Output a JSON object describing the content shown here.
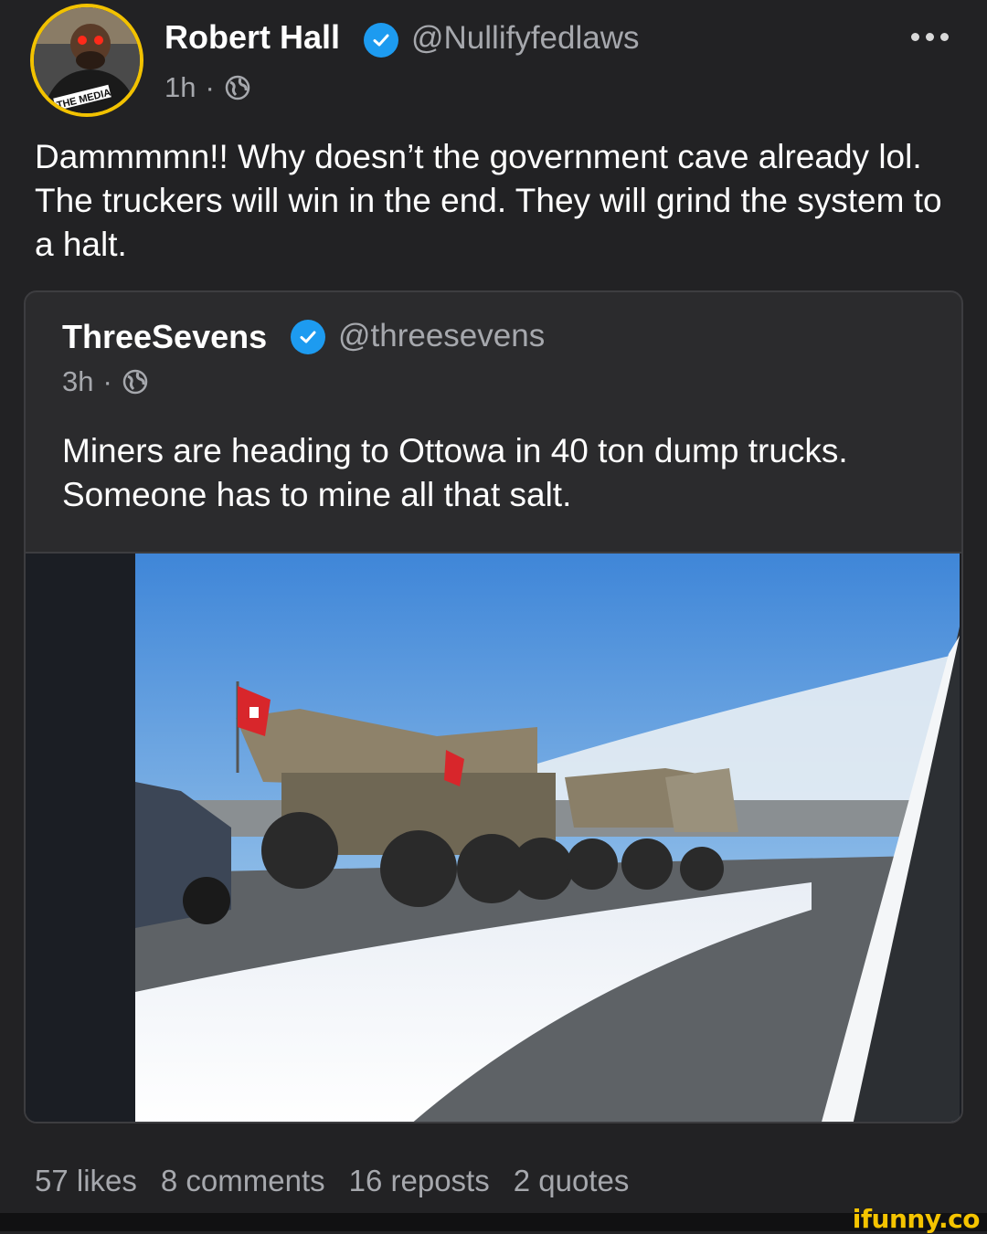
{
  "post": {
    "author": {
      "name": "Robert Hall",
      "handle": "@Nullifyfedlaws",
      "avatar_caption": "THE MEDIA",
      "verified": true
    },
    "time": "1h",
    "separator": "·",
    "visibility_icon": "globe-icon",
    "text": "Dammmmn!! Why doesn’t the government cave already lol. The truckers will win in the end. They will grind the system to a halt.",
    "more_icon": "more-options-icon"
  },
  "quote": {
    "author": {
      "name": "ThreeSevens",
      "handle": "@threesevens",
      "verified": true
    },
    "time": "3h",
    "separator": "·",
    "visibility_icon": "globe-icon",
    "text": "Miners are heading to Ottowa in 40 ton dump trucks. Someone has to mine all that salt."
  },
  "stats": {
    "likes": "57 likes",
    "comments": "8 comments",
    "reposts": "16 reposts",
    "quotes": "2 quotes"
  },
  "watermark": "ifunny.co",
  "colors": {
    "background": "#222224",
    "secondary_text": "#a6a8ad",
    "verified_badge": "#1d9bf0",
    "avatar_ring": "#f2c200",
    "watermark": "#f5c400"
  }
}
